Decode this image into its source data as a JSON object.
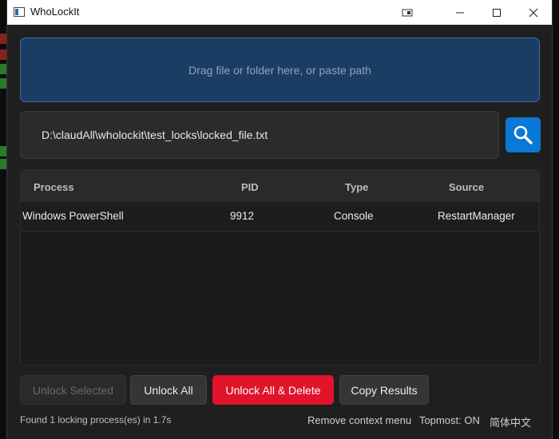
{
  "window": {
    "title": "WhoLockIt"
  },
  "dropzone": {
    "text": "Drag file or folder here, or paste path"
  },
  "path_input": {
    "value": "D:\\claudAll\\wholockit\\test_locks\\locked_file.txt"
  },
  "table": {
    "columns": [
      "Process",
      "PID",
      "Type",
      "Source"
    ],
    "rows": [
      [
        "Windows PowerShell",
        "9912",
        "Console",
        "RestartManager"
      ]
    ]
  },
  "actions": {
    "unlock_selected": "Unlock Selected",
    "unlock_all": "Unlock All",
    "unlock_all_delete": "Unlock All & Delete",
    "copy_results": "Copy Results"
  },
  "footer": {
    "status": "Found 1 locking process(es) in 1.7s",
    "remove_context_menu": "Remove context menu",
    "topmost": "Topmost: ON",
    "language": "简体中文"
  },
  "colors": {
    "accent": "#0a78d6",
    "danger": "#e0142a",
    "dropzone": "#1c3d63"
  }
}
